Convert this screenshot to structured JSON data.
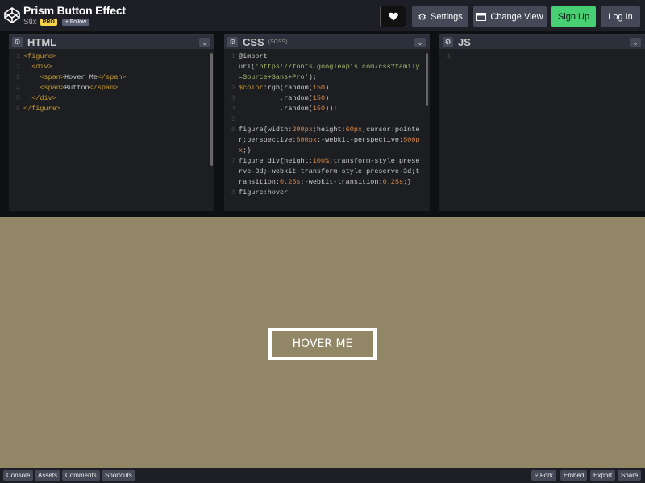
{
  "header": {
    "title": "Prism Button Effect",
    "author": "Stix",
    "pro_badge": "PRO",
    "follow_label": "+ Follow",
    "settings_label": "Settings",
    "change_view_label": "Change View",
    "signup_label": "Sign Up",
    "login_label": "Log In"
  },
  "editors": {
    "html": {
      "name": "HTML",
      "lines": [
        {
          "n": "1",
          "parts": [
            {
              "c": "tag",
              "t": "<figure>"
            }
          ]
        },
        {
          "n": "2",
          "parts": [
            {
              "c": "",
              "t": "  "
            },
            {
              "c": "tag",
              "t": "<div>"
            }
          ]
        },
        {
          "n": "3",
          "parts": [
            {
              "c": "",
              "t": "    "
            },
            {
              "c": "tag",
              "t": "<span>"
            },
            {
              "c": "",
              "t": "Hover Me"
            },
            {
              "c": "tag",
              "t": "</span>"
            }
          ]
        },
        {
          "n": "4",
          "parts": [
            {
              "c": "",
              "t": "    "
            },
            {
              "c": "tag",
              "t": "<span>"
            },
            {
              "c": "",
              "t": "Button"
            },
            {
              "c": "tag",
              "t": "</span>"
            }
          ]
        },
        {
          "n": "5",
          "parts": [
            {
              "c": "",
              "t": "  "
            },
            {
              "c": "tag",
              "t": "</div>"
            }
          ]
        },
        {
          "n": "6",
          "parts": [
            {
              "c": "tag",
              "t": "</figure>"
            }
          ]
        }
      ]
    },
    "css": {
      "name": "CSS",
      "sub": "(SCSS)",
      "lines": [
        {
          "n": "1",
          "parts": [
            {
              "c": "",
              "t": "@import "
            }
          ]
        },
        {
          "n": "",
          "parts": [
            {
              "c": "",
              "t": "url("
            },
            {
              "c": "str",
              "t": "'https://fonts.googleapis.com/css?family=Source+Sans+Pro'"
            },
            {
              "c": "",
              "t": ");"
            }
          ]
        },
        {
          "n": "2",
          "parts": [
            {
              "c": "kw",
              "t": "$color"
            },
            {
              "c": "",
              "t": ":rgb("
            },
            {
              "c": "",
              "t": "random("
            },
            {
              "c": "num",
              "t": "150"
            },
            {
              "c": "",
              "t": ")"
            }
          ]
        },
        {
          "n": "3",
          "parts": [
            {
              "c": "",
              "t": "          ,random("
            },
            {
              "c": "num",
              "t": "150"
            },
            {
              "c": "",
              "t": ")"
            }
          ]
        },
        {
          "n": "4",
          "parts": [
            {
              "c": "",
              "t": "          ,random("
            },
            {
              "c": "num",
              "t": "150"
            },
            {
              "c": "",
              "t": "));"
            }
          ]
        },
        {
          "n": "5",
          "parts": [
            {
              "c": "",
              "t": " "
            }
          ]
        },
        {
          "n": "6",
          "parts": [
            {
              "c": "",
              "t": "figure{width:"
            },
            {
              "c": "num",
              "t": "200px"
            },
            {
              "c": "",
              "t": ";height:"
            },
            {
              "c": "num",
              "t": "60px"
            },
            {
              "c": "",
              "t": ";cursor:pointer;perspective:"
            },
            {
              "c": "num",
              "t": "500px"
            },
            {
              "c": "",
              "t": ";-webkit-perspective:"
            },
            {
              "c": "num",
              "t": "500px"
            },
            {
              "c": "",
              "t": ";}"
            }
          ]
        },
        {
          "n": "7",
          "parts": [
            {
              "c": "",
              "t": "figure div{height:"
            },
            {
              "c": "num",
              "t": "100%"
            },
            {
              "c": "",
              "t": ";transform-style:preserve-3d;-webkit-transform-style:preserve-3d;transition:"
            },
            {
              "c": "num",
              "t": "0.25s"
            },
            {
              "c": "",
              "t": ";-webkit-transition:"
            },
            {
              "c": "num",
              "t": "0.25s"
            },
            {
              "c": "",
              "t": ";}"
            }
          ]
        },
        {
          "n": "8",
          "parts": [
            {
              "c": "",
              "t": "figure:hover"
            }
          ]
        }
      ]
    },
    "js": {
      "name": "JS",
      "lines": [
        {
          "n": "1",
          "parts": [
            {
              "c": "",
              "t": ""
            }
          ]
        }
      ]
    }
  },
  "preview": {
    "button_label": "HOVER ME",
    "background_color": "#918665"
  },
  "footer": {
    "left": [
      "Console",
      "Assets",
      "Comments",
      "Shortcuts"
    ],
    "fork_label": "Fork",
    "embed_label": "Embed",
    "export_label": "Export",
    "share_label": "Share"
  }
}
